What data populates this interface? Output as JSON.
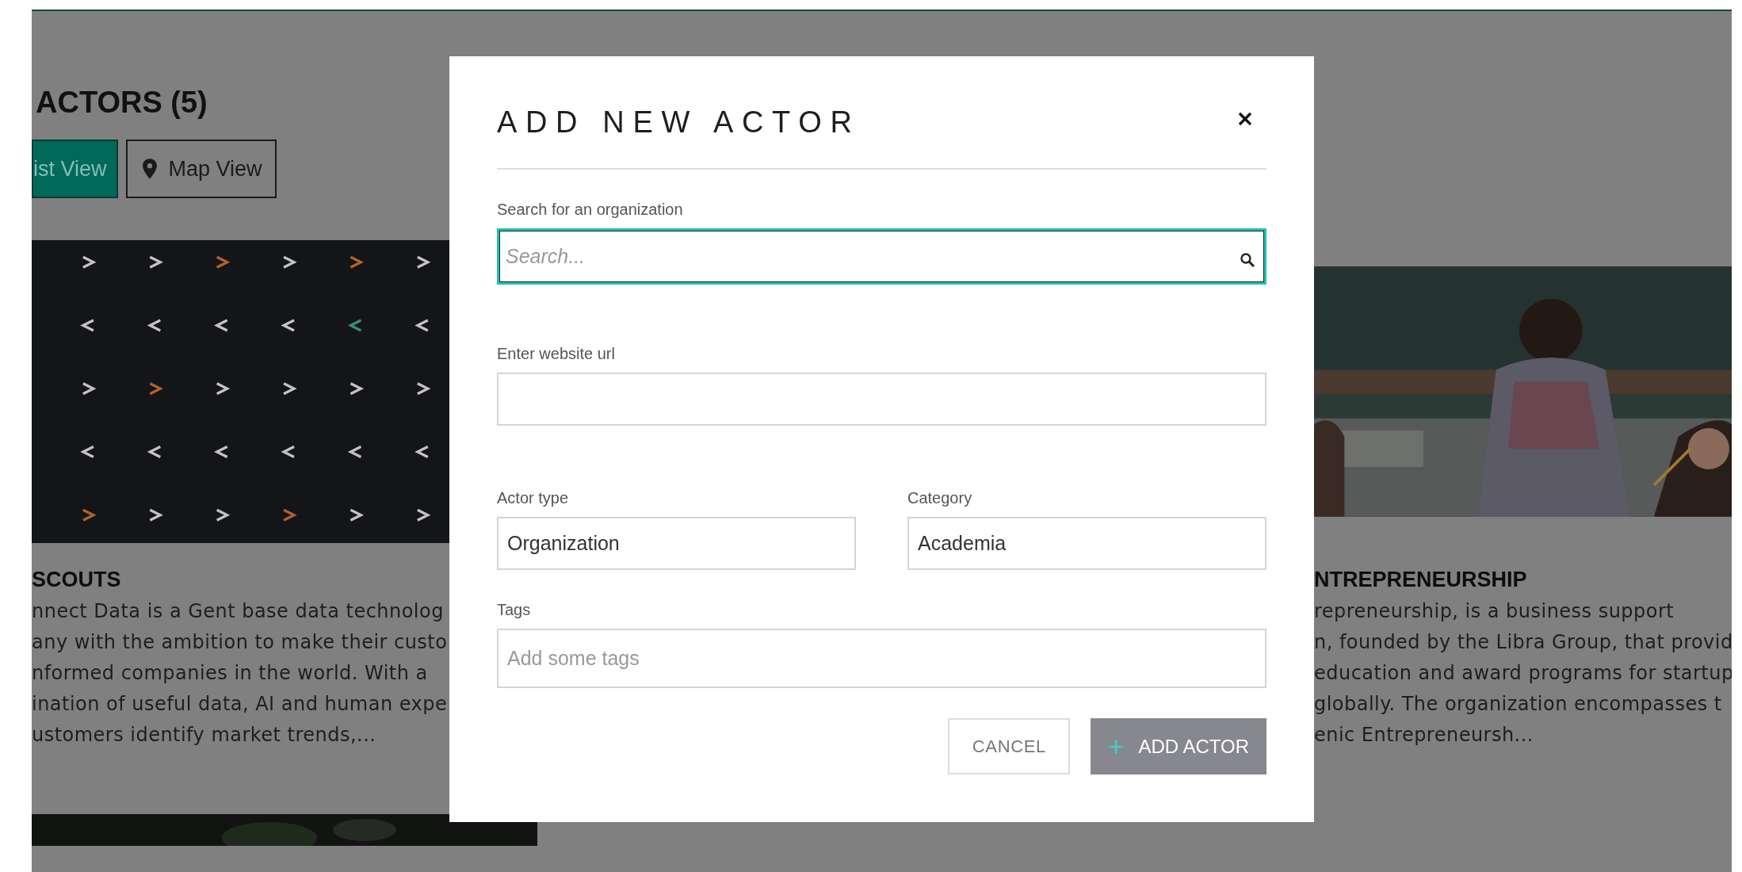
{
  "page": {
    "heading": "ACTORS (5)",
    "view_toggle": [
      {
        "label": "ist View",
        "kind": "list",
        "selected": true
      },
      {
        "label": "Map View",
        "kind": "map",
        "selected": false
      }
    ]
  },
  "cards": [
    {
      "title": "SCOUTS",
      "description_lines": [
        "nnect Data is a Gent base data technolog",
        "any with the ambition to make their custo",
        "nformed companies in the world. With a",
        "ination of useful data, AI and human expe",
        "ustomers identify market trends,..."
      ]
    },
    {
      "title": "NTREPRENEURSHIP",
      "description_lines": [
        "repreneurship, is a business support",
        "n, founded by the Libra Group, that provid",
        "education and award programs for startup",
        "globally. The organization encompasses t",
        "enic Entrepreneursh..."
      ]
    }
  ],
  "modal": {
    "title": "ADD NEW ACTOR",
    "rows": [
      [
        {
          "label": "Search for an organization",
          "placeholder": "Search...",
          "kind": "search",
          "focused": true
        }
      ],
      [
        {
          "label": "Enter website url",
          "kind": "text",
          "focused": false
        }
      ],
      [
        {
          "label": "Actor type",
          "value": "Organization",
          "kind": "text",
          "focused": false
        },
        {
          "label": "Category",
          "value": "Academia",
          "kind": "text",
          "focused": false
        }
      ],
      [
        {
          "label": "Tags",
          "placeholder": "Add some tags",
          "kind": "tags",
          "focused": false
        }
      ]
    ],
    "buttons": [
      {
        "label": "CANCEL",
        "kind": "secondary"
      },
      {
        "label": "ADD ACTOR",
        "kind": "primary"
      }
    ]
  }
}
